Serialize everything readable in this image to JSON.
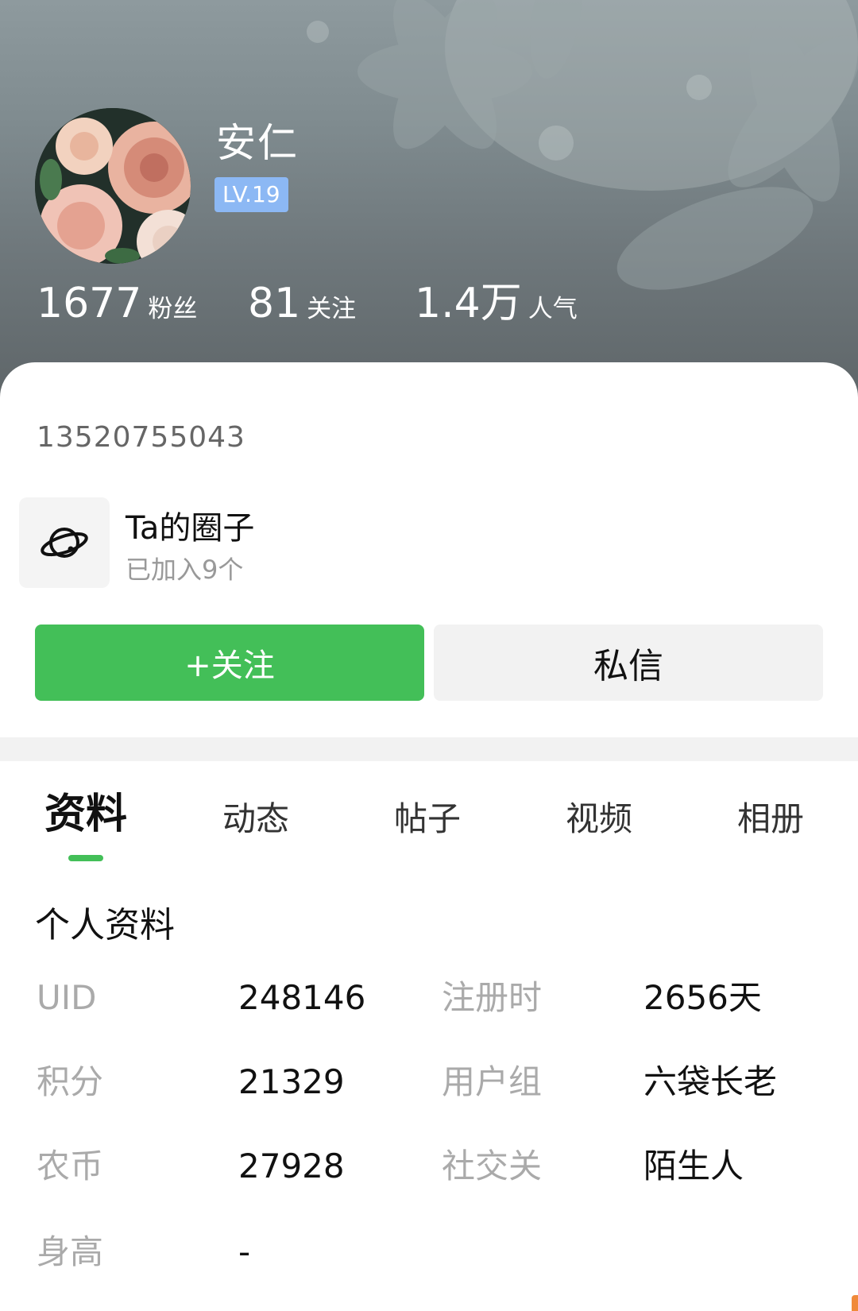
{
  "profile": {
    "name": "安仁",
    "level": "LV.19",
    "stats": [
      {
        "value": "1677",
        "label": "粉丝"
      },
      {
        "value": "81",
        "label": "关注"
      },
      {
        "value": "1.4万",
        "label": "人气"
      }
    ],
    "user_code": "13520755043"
  },
  "circle": {
    "title": "Ta的圈子",
    "subtitle": "已加入9个",
    "icon": "planet-icon"
  },
  "actions": {
    "follow_label": "+关注",
    "message_label": "私信"
  },
  "tabs": [
    {
      "label": "资料",
      "active": true
    },
    {
      "label": "动态",
      "active": false
    },
    {
      "label": "帖子",
      "active": false
    },
    {
      "label": "视频",
      "active": false
    },
    {
      "label": "相册",
      "active": false
    }
  ],
  "info": {
    "title": "个人资料",
    "rows": [
      [
        {
          "label": "UID",
          "value": "248146"
        },
        {
          "label": "注册时",
          "value": "2656天"
        }
      ],
      [
        {
          "label": "积分",
          "value": "21329"
        },
        {
          "label": "用户组",
          "value": "六袋长老"
        }
      ],
      [
        {
          "label": "农币",
          "value": "27928"
        },
        {
          "label": "社交关",
          "value": "陌生人"
        }
      ],
      [
        {
          "label": "身高",
          "value": "-"
        }
      ]
    ]
  },
  "colors": {
    "accent": "#43bf58",
    "level_badge": "#8cb8f4"
  }
}
